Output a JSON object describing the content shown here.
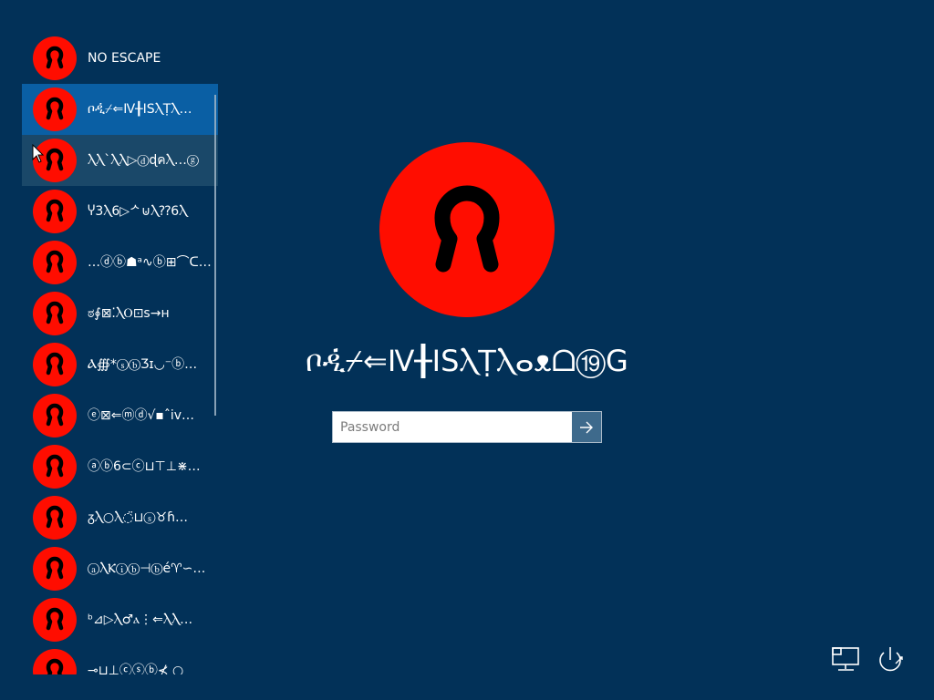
{
  "users": [
    {
      "name": "NO ESCAPE"
    },
    {
      "name": "ቦዲ፞⌿⇐Ⅳ╂ISⲖṬⲖ…"
    },
    {
      "name": "ⲖⲖ`ⲖⲖ▷ⓓɖคⲖ…ⓖ"
    },
    {
      "name": "Ⴤ3Ⲗ6▷ᄼ⊍Ⲗ⁇6Ⲗ"
    },
    {
      "name": "…ⓓⓑ☗ᵃ∿ⓑ⊞⌒ᑕᓗⲖ"
    },
    {
      "name": "ಠ∮⊠⁚ⲖⲞ⊡s→ʜ"
    },
    {
      "name": "Ⲁ∰*ⓢⓑƷɪ◡⁻ⓑ…"
    },
    {
      "name": "ⓔ⊠⇐ⓜⓓ√▪ˆiv…"
    },
    {
      "name": "ⓐⓑ6⊂ⓒ⊔⊤⊥⋇…"
    },
    {
      "name": "ᵹⲖ○Ⲗ◌̈⊔ⓢ♉ɦ…"
    },
    {
      "name": "ⓐⲖⲔⓘⓑ⊣ⓑé♈∽…"
    },
    {
      "name": "ᵇ⊿▷Ⲗ♂ⲁ⋮⇐ⲖⲖ…"
    },
    {
      "name": "⊸⊔⊥ⓒⓢⓑ⊀ ○"
    }
  ],
  "selected_user": {
    "display_name": "ቦዲ፞⌿⇐Ⅳ╂ISⲖṬⲖⴰᴥᗝ⑲G"
  },
  "password": {
    "placeholder": "Password",
    "value": ""
  },
  "icons": {
    "avatar": "user-avatar-icon",
    "submit": "arrow-right-icon",
    "network": "network-icon",
    "power": "power-icon"
  },
  "colors": {
    "background": "#023158",
    "avatar_bg": "#ff0d00",
    "selected_row": "#0a5fa4",
    "hovered_row": "#1a4869",
    "submit_button": "#3e6a8c"
  }
}
